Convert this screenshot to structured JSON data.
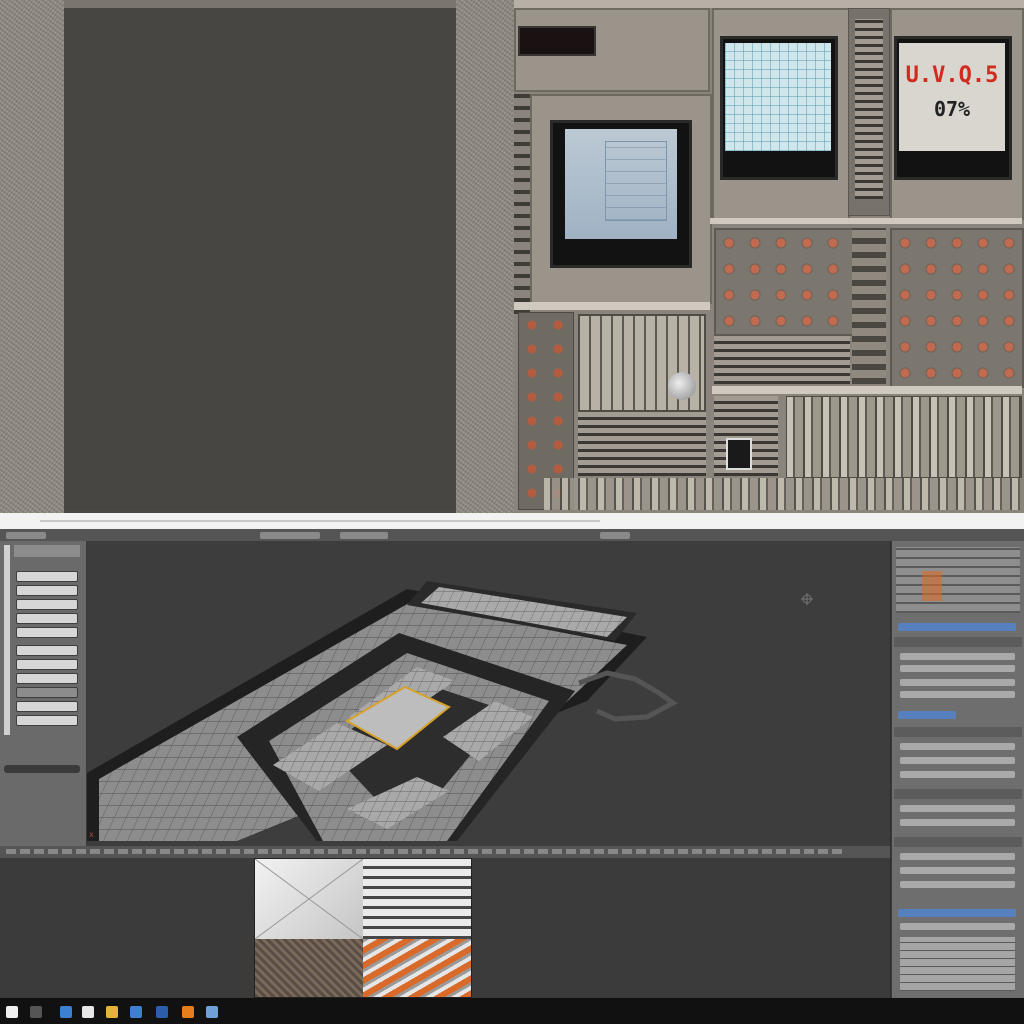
{
  "texture_sheet": {
    "led_display": "",
    "status_screen": {
      "line1": "U.V.Q.5",
      "line2": "07%"
    }
  },
  "editor": {
    "menu_bar": "",
    "viewport_label": "",
    "tray_time": ""
  },
  "colors": {
    "background": "#2b2b2b",
    "viewport": "#3d3d3d",
    "panel": "#6a6a6a",
    "accent_blue": "#5780bf",
    "highlight_orange": "#d96a2a",
    "status_red": "#d12a1f"
  },
  "icons": [
    "start-icon",
    "folder-icon",
    "browser-icon",
    "blender-icon",
    "app-icon",
    "app-icon",
    "app-icon",
    "app-icon",
    "app-icon"
  ]
}
